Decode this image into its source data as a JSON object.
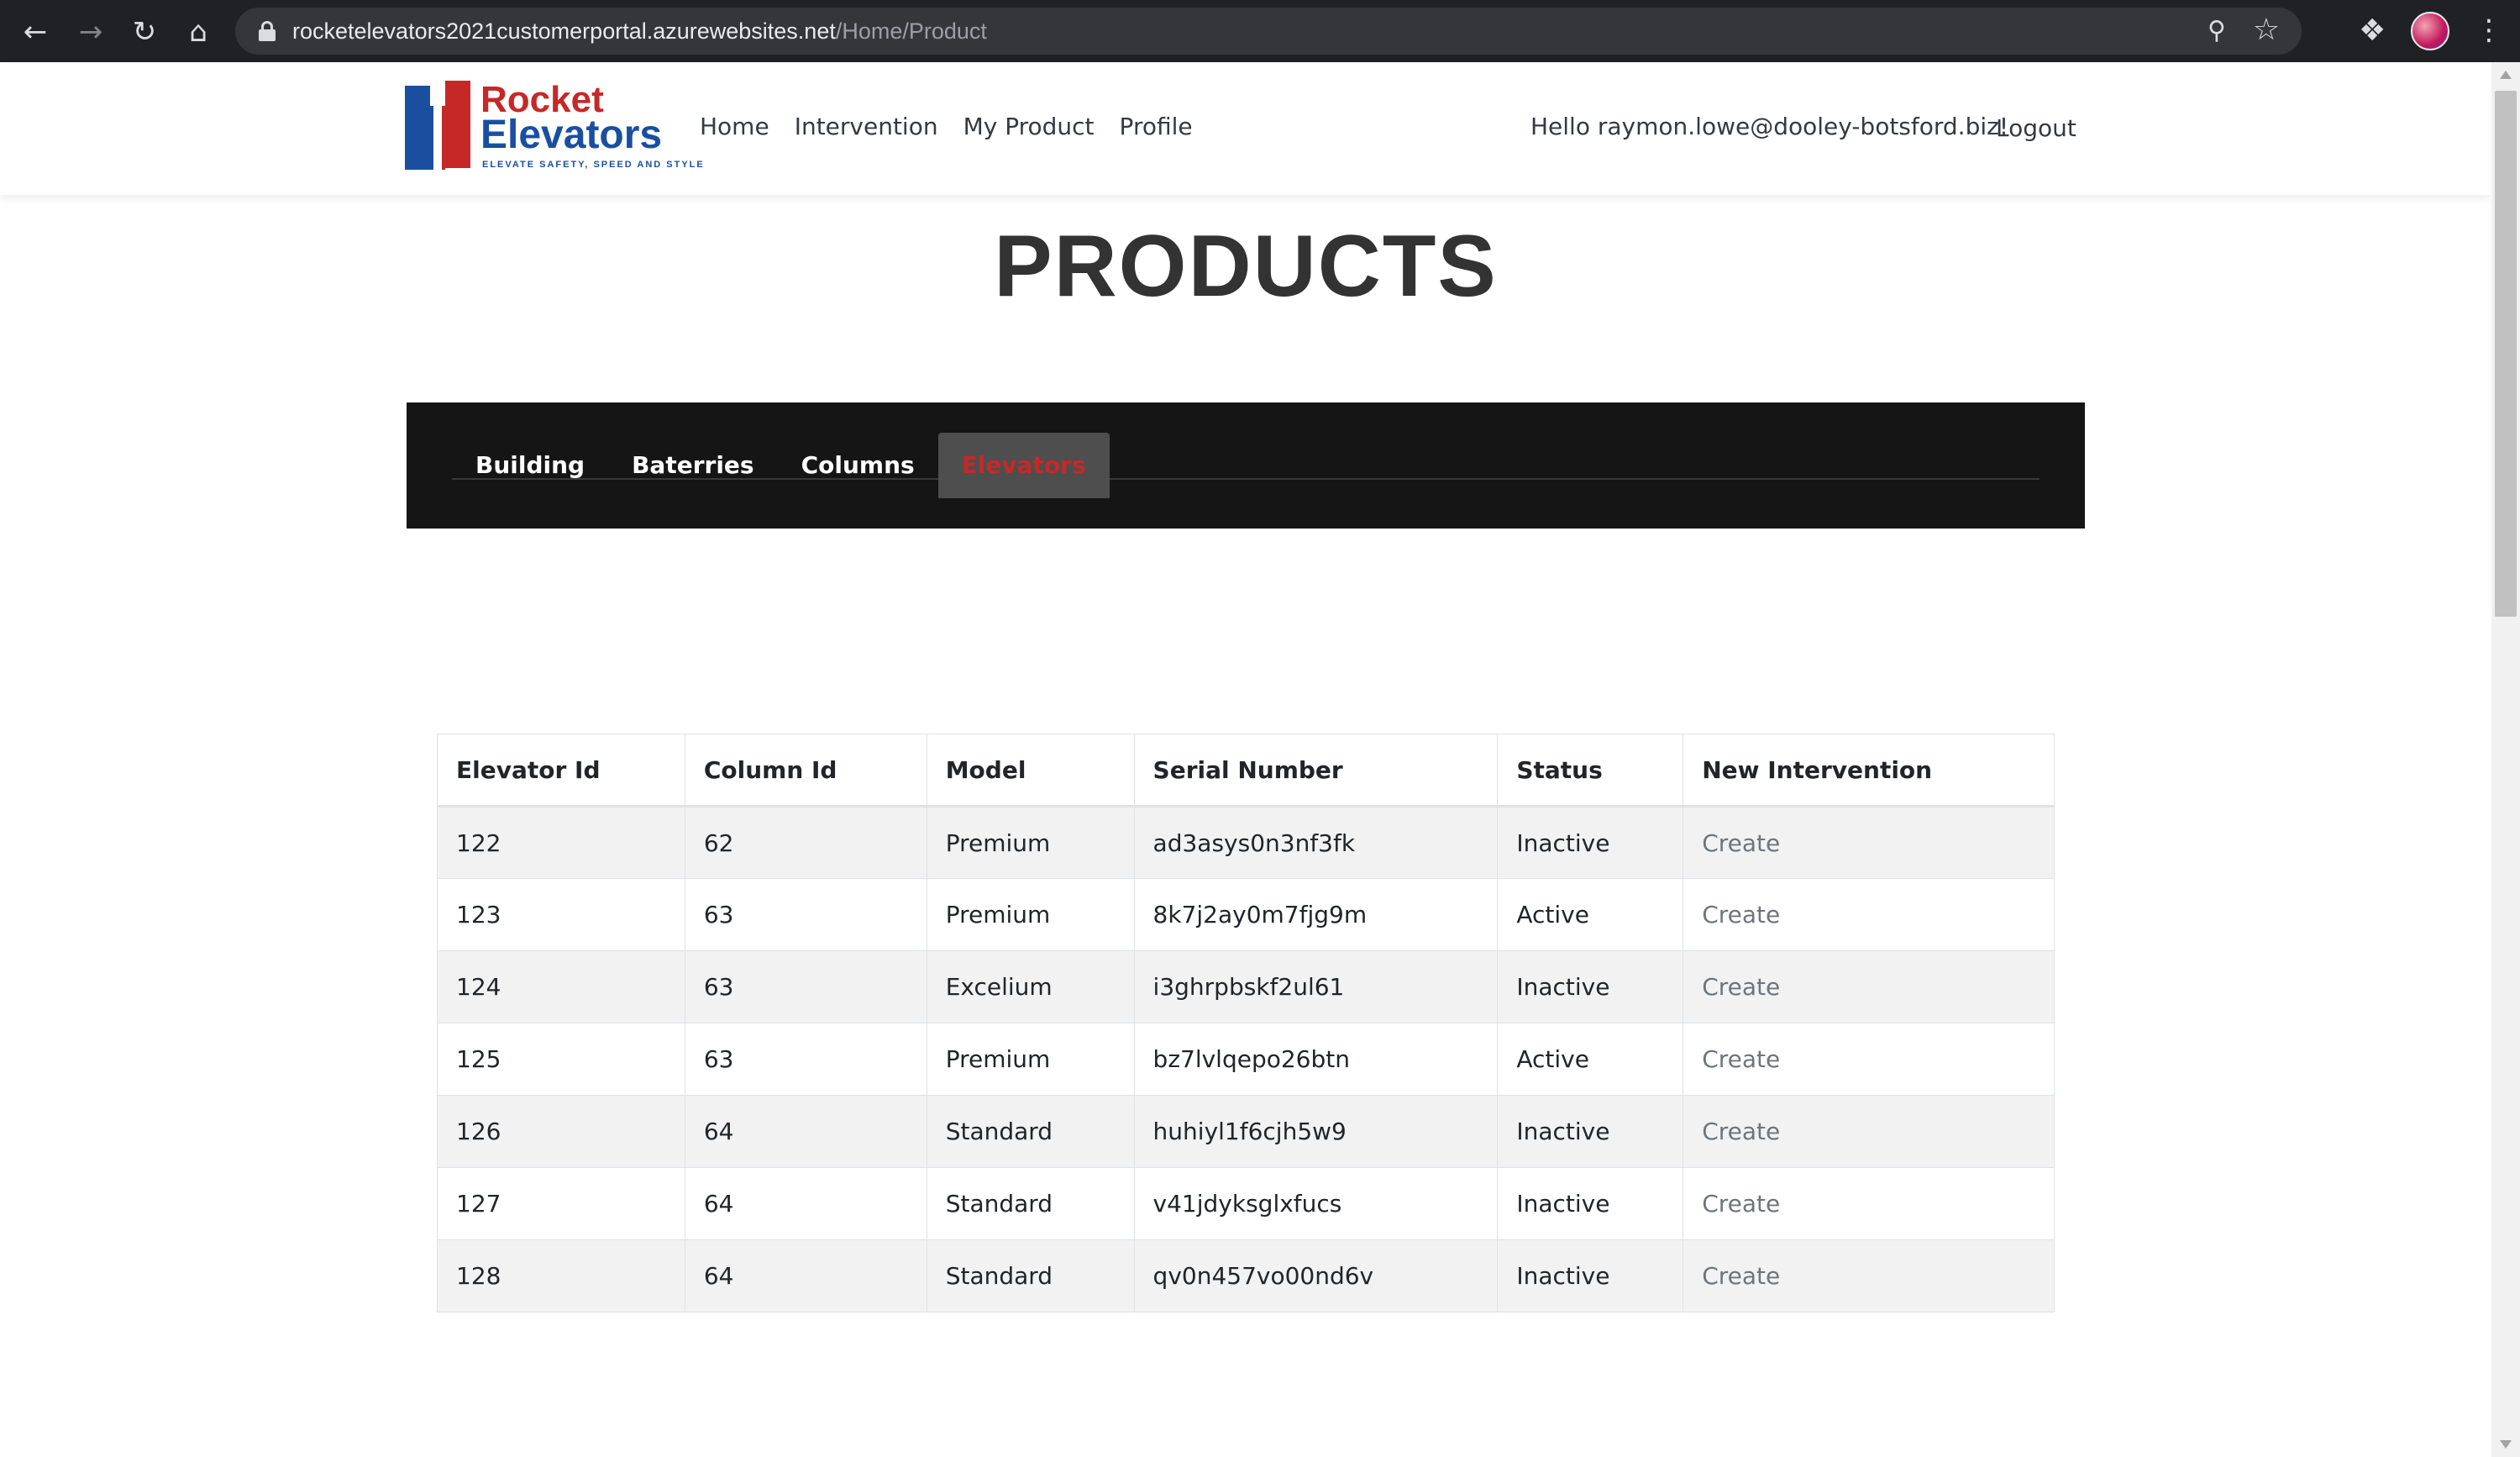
{
  "browser": {
    "url_domain": "rocketelevators2021customerportal.azurewebsites.net",
    "url_path": "/Home/Product"
  },
  "logo": {
    "word1": "Rocket",
    "word2": "Elevators",
    "tagline": "ELEVATE SAFETY, SPEED AND STYLE"
  },
  "nav": {
    "links": [
      "Home",
      "Intervention",
      "My Product",
      "Profile"
    ],
    "greeting": "Hello raymon.lowe@dooley-botsford.biz!",
    "logout": "Logout"
  },
  "page": {
    "title": "PRODUCTS"
  },
  "tabs": {
    "items": [
      "Building",
      "Baterries",
      "Columns",
      "Elevators"
    ],
    "active": "Elevators"
  },
  "table": {
    "headers": [
      "Elevator Id",
      "Column Id",
      "Model",
      "Serial Number",
      "Status",
      "New Intervention"
    ],
    "rows": [
      [
        "122",
        "62",
        "Premium",
        "ad3asys0n3nf3fk",
        "Inactive",
        "Create"
      ],
      [
        "123",
        "63",
        "Premium",
        "8k7j2ay0m7fjg9m",
        "Active",
        "Create"
      ],
      [
        "124",
        "63",
        "Excelium",
        "i3ghrpbskf2ul61",
        "Inactive",
        "Create"
      ],
      [
        "125",
        "63",
        "Premium",
        "bz7lvlqepo26btn",
        "Active",
        "Create"
      ],
      [
        "126",
        "64",
        "Standard",
        "huhiyl1f6cjh5w9",
        "Inactive",
        "Create"
      ],
      [
        "127",
        "64",
        "Standard",
        "v41jdyksglxfucs",
        "Inactive",
        "Create"
      ],
      [
        "128",
        "64",
        "Standard",
        "qv0n457vo00nd6v",
        "Inactive",
        "Create"
      ]
    ]
  },
  "colors": {
    "brand_red": "#c62828",
    "brand_blue": "#1a4fa0",
    "tab_panel_bg": "#151515"
  }
}
